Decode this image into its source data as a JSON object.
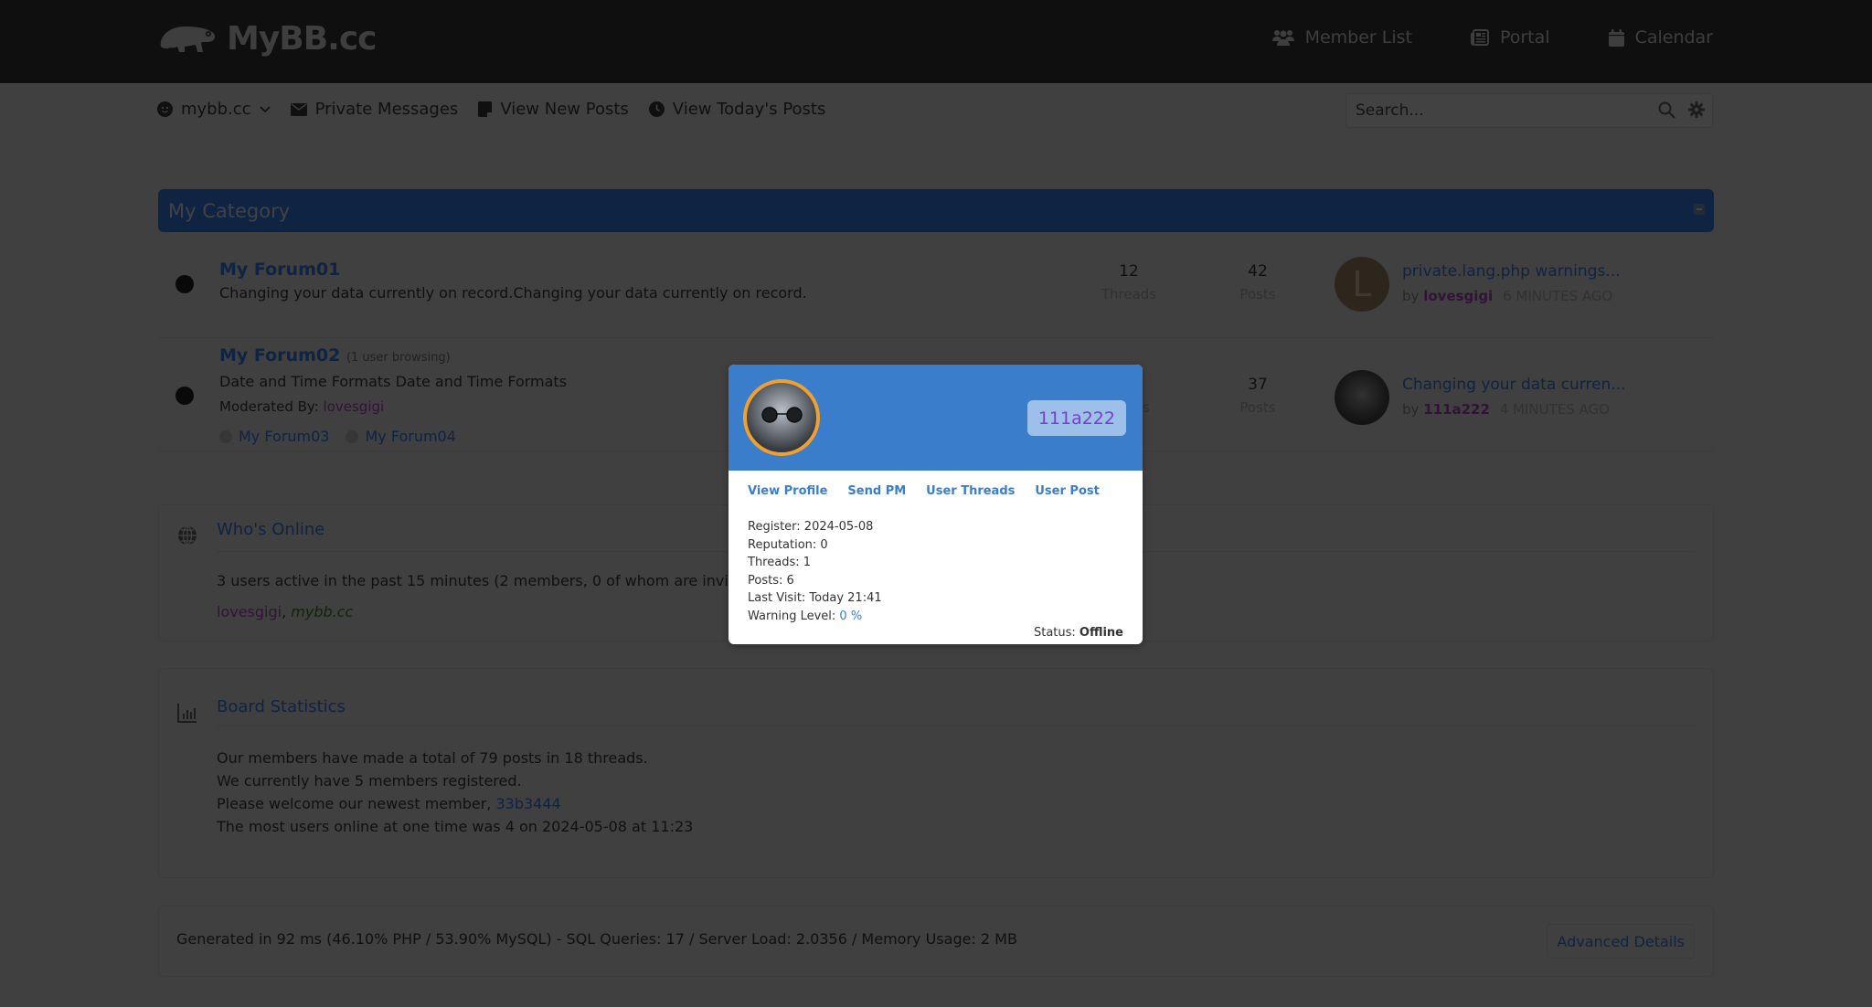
{
  "header": {
    "logo_text": "MyBB.cc",
    "nav": [
      {
        "label": "Member List",
        "icon": "users-icon"
      },
      {
        "label": "Portal",
        "icon": "newspaper-icon"
      },
      {
        "label": "Calendar",
        "icon": "calendar-icon"
      }
    ]
  },
  "subnav": {
    "user_menu": "mybb.cc",
    "items": [
      {
        "label": "Private Messages",
        "icon": "envelope-icon"
      },
      {
        "label": "View New Posts",
        "icon": "note-icon"
      },
      {
        "label": "View Today's Posts",
        "icon": "clock-icon"
      }
    ],
    "search_placeholder": "Search..."
  },
  "category": {
    "title": "My Category",
    "forums": [
      {
        "title": "My Forum01",
        "description": "Changing your data currently on record.Changing your data currently on record.",
        "threads": "12",
        "threads_label": "Threads",
        "posts": "42",
        "posts_label": "Posts",
        "lastpost": {
          "avatar_letter": "L",
          "title": "private.lang.php warnings...",
          "by": "by",
          "user": "lovesgigi",
          "time": "6 minutes ago"
        }
      },
      {
        "title": "My Forum02",
        "browsing": "(1 user browsing)",
        "description": "Date and Time Formats Date and Time Formats",
        "moderated_label": "Moderated By:",
        "moderator": "lovesgigi",
        "subforums": [
          "My Forum03",
          "My Forum04"
        ],
        "threads_label_partial": "ds",
        "posts": "37",
        "posts_label": "Posts",
        "lastpost": {
          "title": "Changing your data curren...",
          "by": "by",
          "user": "111a222",
          "time": "4 minutes ago"
        }
      }
    ]
  },
  "whos_online": {
    "title": "Who's Online",
    "summary": "3 users active in the past 15 minutes (2 members, 0 of whom are invisibl",
    "users": [
      {
        "name": "lovesgigi",
        "role": "admin"
      },
      {
        "name": "mybb.cc",
        "role": "mod"
      }
    ],
    "separator": ", "
  },
  "board_stats": {
    "title": "Board Statistics",
    "line1": "Our members have made a total of 79 posts in 18 threads.",
    "line2": "We currently have 5 members registered.",
    "line3_prefix": "Please welcome our newest member, ",
    "newest_member": "33b3444",
    "line4": "The most users online at one time was 4 on 2024-05-08 at 11:23"
  },
  "footer": {
    "debug": "Generated in 92 ms (46.10% PHP / 53.90% MySQL) - SQL Queries: 17 / Server Load: 2.0356 / Memory Usage: 2 MB",
    "advanced_button": "Advanced Details"
  },
  "popup": {
    "username": "111a222",
    "links": [
      "View Profile",
      "Send PM",
      "User Threads",
      "User Post"
    ],
    "register": "Register: 2024-05-08",
    "reputation": "Reputation: 0",
    "threads": "Threads: 1",
    "posts": "Posts: 6",
    "last_visit": "Last Visit: Today 21:41",
    "warning_label": "Warning Level: ",
    "warning_value": "0 %",
    "status_label": "Status: ",
    "status_value": "Offline"
  },
  "colors": {
    "popup_header": "#3a7dcb",
    "avatar_ring": "#f0a030",
    "username_purple": "#7a3fc8",
    "category_header": "#1a3d74"
  }
}
